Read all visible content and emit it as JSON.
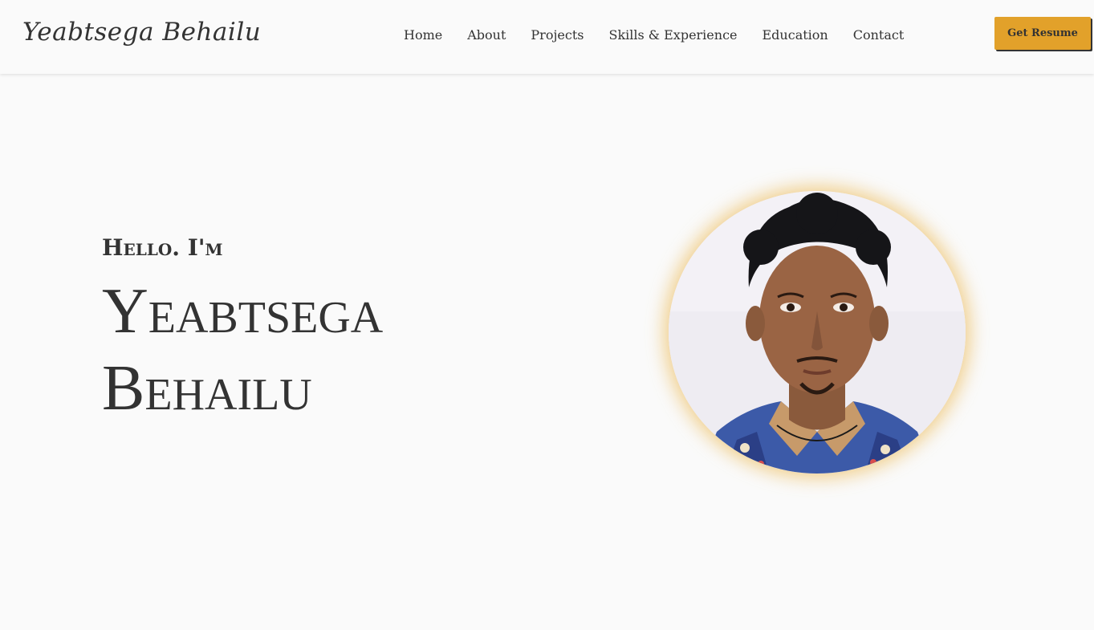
{
  "header": {
    "logo": "Yeabtsega Behailu",
    "nav": [
      "Home",
      "About",
      "Projects",
      "Skills & Experience",
      "Education",
      "Contact"
    ],
    "resume_button": "Get Resume"
  },
  "hero": {
    "greeting": "Hello. I'm",
    "name_line1": "Yeabtsega",
    "name_line2": "Behailu",
    "photo_icon": "profile-photo"
  },
  "colors": {
    "accent": "#e2a12a",
    "text": "#333333",
    "background": "#fafafa",
    "glow": "#ecbe60"
  }
}
